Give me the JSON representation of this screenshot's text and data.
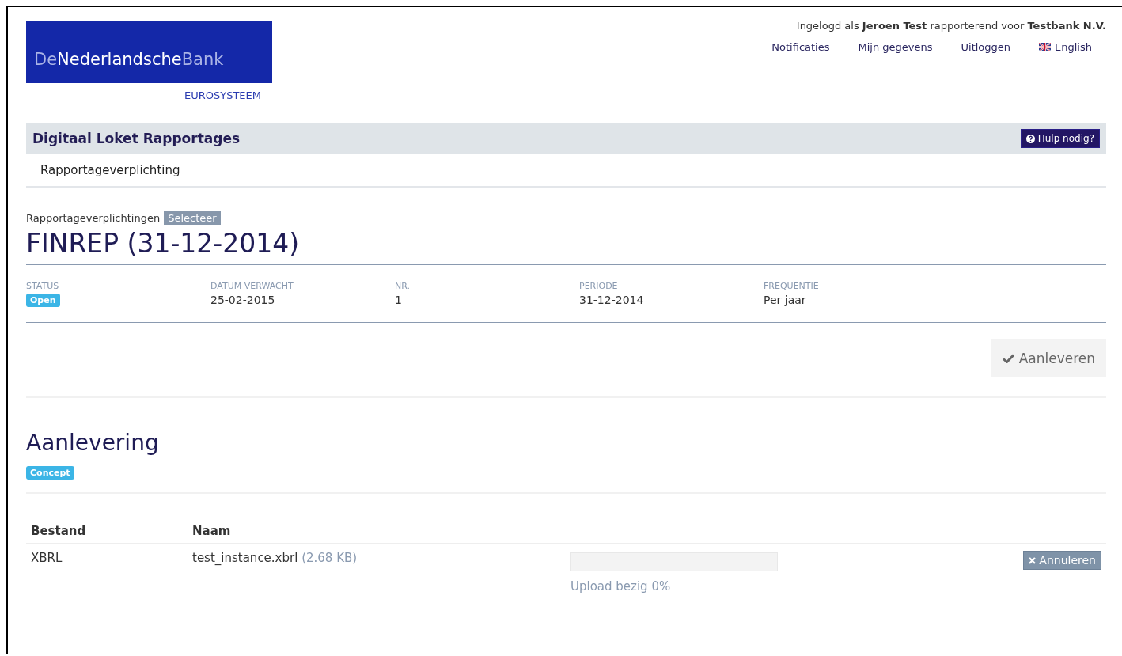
{
  "logo": {
    "parts": [
      "De",
      "Nederlandsche",
      "Bank"
    ],
    "subtitle": "EUROSYSTEEM"
  },
  "user_info": "Ingelogd als **Jeroen Test** rapporterend voor **Testbank N.V.**",
  "top_links": [
    {
      "label": "Notificaties",
      "kind": "link"
    },
    {
      "label": "Mijn gegevens",
      "kind": "link"
    },
    {
      "label": "Uitloggen",
      "kind": "link"
    },
    {
      "label": "English",
      "kind": "language"
    }
  ],
  "app_bar": {
    "title": "Digitaal Loket Rapportages",
    "help_button": "Hulp nodig?"
  },
  "nav": [
    {
      "label": "Rapportageverplichting"
    }
  ],
  "breadcrumb": {
    "label": "Rapportageverplichtingen",
    "button": "Selecteer"
  },
  "page_title": "FINREP (31-12-2014)",
  "meta": [
    {
      "label": "STATUS",
      "value": "Open",
      "kind": "badge"
    },
    {
      "label": "DATUM VERWACHT",
      "value": "25-02-2015",
      "kind": "text"
    },
    {
      "label": "NR.",
      "value": "1",
      "kind": "text"
    },
    {
      "label": "PERIODE",
      "value": "31-12-2014",
      "kind": "text"
    },
    {
      "label": "FREQUENTIE",
      "value": "Per jaar",
      "kind": "text"
    }
  ],
  "submit_button": {
    "label": "Aanleveren",
    "disabled": true
  },
  "delivery": {
    "title": "Aanlevering",
    "status": "Concept"
  },
  "table": {
    "columns": [
      "Bestand",
      "Naam"
    ],
    "rows": [
      {
        "type": "XBRL",
        "name": "test_instance.xbrl",
        "size": "(2.68 KB)",
        "level": 0,
        "progress_text": "Upload bezig 0%",
        "cancel_button": "Annuleren"
      }
    ]
  }
}
